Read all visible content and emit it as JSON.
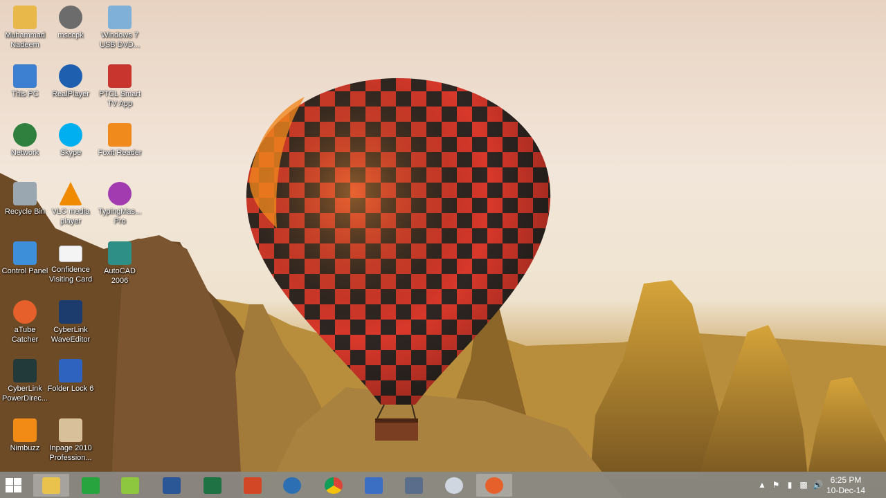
{
  "desktop": {
    "icons": [
      {
        "label": "Muhammad Nadeem",
        "icon": "user-folder-icon",
        "color": "#e8b84a"
      },
      {
        "label": "msccpk",
        "icon": "webcam-icon",
        "color": "#6c6c6c"
      },
      {
        "label": "Windows 7 USB DVD...",
        "icon": "usb-dvd-tool-icon",
        "color": "#7fb0d8"
      },
      {
        "label": "This PC",
        "icon": "computer-icon",
        "color": "#3d7fd0"
      },
      {
        "label": "RealPlayer",
        "icon": "realplayer-icon",
        "color": "#1f5fb0"
      },
      {
        "label": "PTCL Smart TV App",
        "icon": "ptcl-tv-icon",
        "color": "#c8352e"
      },
      {
        "label": "Network",
        "icon": "network-globe-icon",
        "color": "#2f7f3f"
      },
      {
        "label": "Skype",
        "icon": "skype-icon",
        "color": "#00aff0"
      },
      {
        "label": "Foxit Reader",
        "icon": "foxit-reader-icon",
        "color": "#f08a1c"
      },
      {
        "label": "Recycle Bin",
        "icon": "recycle-bin-icon",
        "color": "#9aa6b0"
      },
      {
        "label": "VLC media player",
        "icon": "vlc-cone-icon",
        "color": "#f08a00"
      },
      {
        "label": "TypingMas... Pro",
        "icon": "typingmaster-icon",
        "color": "#a23ab0"
      },
      {
        "label": "Control Panel",
        "icon": "control-panel-icon",
        "color": "#3c8fd8"
      },
      {
        "label": "Confidence Visiting Card",
        "icon": "visiting-card-icon",
        "color": "#f4f4f4"
      },
      {
        "label": "AutoCAD 2006",
        "icon": "autocad-icon",
        "color": "#2e8f86"
      },
      {
        "label": "aTube Catcher",
        "icon": "atube-catcher-icon",
        "color": "#e5602a"
      },
      {
        "label": "CyberLink WaveEditor",
        "icon": "waveeditor-icon",
        "color": "#1c3c6e"
      },
      {
        "label": "CyberLink PowerDirec...",
        "icon": "powerdirector-icon",
        "color": "#223a3a"
      },
      {
        "label": "Folder Lock 6",
        "icon": "folder-lock-icon",
        "color": "#2f63c0"
      },
      {
        "label": "Nimbuzz",
        "icon": "nimbuzz-icon",
        "color": "#f28a16"
      },
      {
        "label": "Inpage 2010 Profession...",
        "icon": "inpage-icon",
        "color": "#d8c09a"
      }
    ]
  },
  "taskbar": {
    "apps": [
      {
        "name": "File Explorer",
        "icon": "file-explorer-icon",
        "color": "#e9c24e",
        "active": true
      },
      {
        "name": "Store",
        "icon": "store-icon",
        "color": "#27a43e",
        "active": false
      },
      {
        "name": "Notepad++",
        "icon": "notepadpp-icon",
        "color": "#8dc63f",
        "active": false
      },
      {
        "name": "Word",
        "icon": "word-icon",
        "color": "#2b5797",
        "active": false
      },
      {
        "name": "Excel",
        "icon": "excel-icon",
        "color": "#1f7244",
        "active": false
      },
      {
        "name": "PowerPoint",
        "icon": "powerpoint-icon",
        "color": "#d24726",
        "active": false
      },
      {
        "name": "Media Player",
        "icon": "media-player-icon",
        "color": "#2d6fb3",
        "active": false
      },
      {
        "name": "Chrome",
        "icon": "chrome-icon",
        "color": "#db4437",
        "active": false
      },
      {
        "name": "Visual C",
        "icon": "visual-c-icon",
        "color": "#3a6fc4",
        "active": false
      },
      {
        "name": "Screen Recorder",
        "icon": "screen-recorder-icon",
        "color": "#5a6e8c",
        "active": false
      },
      {
        "name": "Paint Tool",
        "icon": "paint-tool-icon",
        "color": "#d0d6e0",
        "active": false
      },
      {
        "name": "aTube Catcher",
        "icon": "atube-catcher-icon",
        "color": "#e5602a",
        "active": true
      }
    ],
    "tray": {
      "time": "6:25 PM",
      "date": "10-Dec-14"
    }
  }
}
